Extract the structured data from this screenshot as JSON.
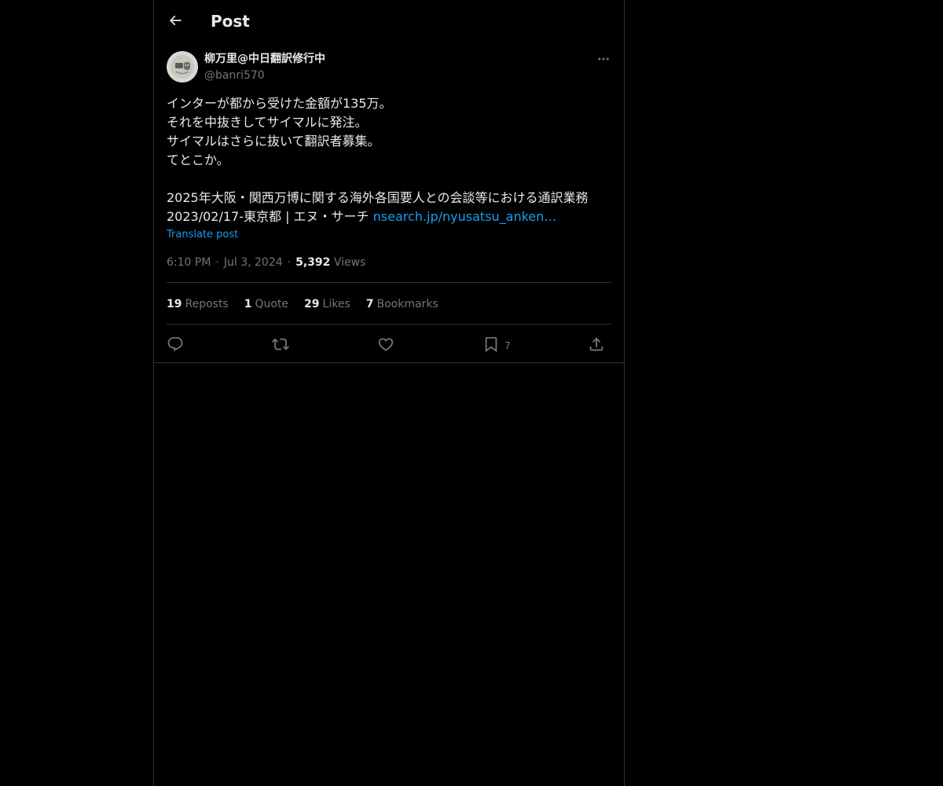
{
  "header": {
    "title": "Post"
  },
  "author": {
    "display_name": "柳万里@中日翻訳修行中",
    "handle": "@banri570"
  },
  "post": {
    "lines": [
      "インターが都から受けた金額が135万。",
      "それを中抜きしてサイマルに発注。",
      "サイマルはさらに抜いて翻訳者募集。",
      "てとこか。"
    ],
    "line_5": "2025年大阪・関西万博に関する海外各国要人との会談等における通訳業務",
    "line_6_prefix": "2023/02/17-東京都 | エヌ・サーチ ",
    "link_text": "nsearch.jp/nyusatsu_anken…",
    "translate_label": "Translate post"
  },
  "meta": {
    "time": "6:10 PM",
    "date": "Jul 3, 2024",
    "views_count": "5,392",
    "views_label": "Views"
  },
  "stats": {
    "reposts_count": "19",
    "reposts_label": "Reposts",
    "quote_count": "1",
    "quote_label": "Quote",
    "likes_count": "29",
    "likes_label": "Likes",
    "bookmarks_count": "7",
    "bookmarks_label": "Bookmarks"
  },
  "actions": {
    "bookmark_count": "7"
  },
  "icons": {
    "back": "arrow-left-icon",
    "more": "more-horizontal-icon",
    "reply": "reply-icon",
    "repost": "repost-icon",
    "like": "heart-icon",
    "bookmark": "bookmark-icon",
    "share": "share-icon"
  },
  "colors": {
    "background": "#000000",
    "text": "#e7e9ea",
    "secondary_text": "#71767b",
    "link": "#1d9bf0",
    "border": "#2f3336"
  }
}
